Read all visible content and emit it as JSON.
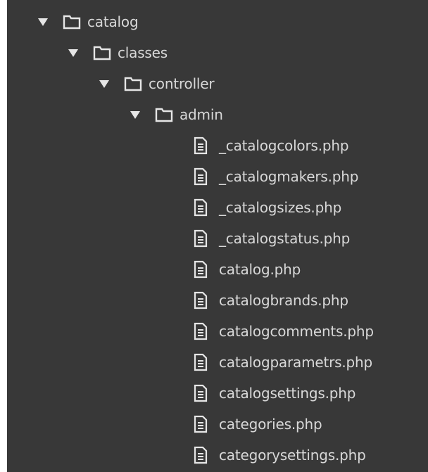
{
  "colors": {
    "panel_bg": "#383838",
    "text": "#d8d8d8",
    "icon": "#e6e6e6"
  },
  "tree": {
    "folders": [
      {
        "name": "catalog",
        "icon": "folder-icon",
        "expanded": true
      },
      {
        "name": "classes",
        "icon": "folder-icon",
        "expanded": true
      },
      {
        "name": "controller",
        "icon": "folder-icon",
        "expanded": true
      },
      {
        "name": "admin",
        "icon": "folder-icon",
        "expanded": true
      }
    ],
    "files": [
      {
        "name": "_catalogcolors.php",
        "icon": "file-icon"
      },
      {
        "name": "_catalogmakers.php",
        "icon": "file-icon"
      },
      {
        "name": "_catalogsizes.php",
        "icon": "file-icon"
      },
      {
        "name": "_catalogstatus.php",
        "icon": "file-icon"
      },
      {
        "name": "catalog.php",
        "icon": "file-icon"
      },
      {
        "name": "catalogbrands.php",
        "icon": "file-icon"
      },
      {
        "name": "catalogcomments.php",
        "icon": "file-icon"
      },
      {
        "name": "catalogparametrs.php",
        "icon": "file-icon"
      },
      {
        "name": "catalogsettings.php",
        "icon": "file-icon"
      },
      {
        "name": "categories.php",
        "icon": "file-icon"
      },
      {
        "name": "categorysettings.php",
        "icon": "file-icon"
      }
    ]
  }
}
